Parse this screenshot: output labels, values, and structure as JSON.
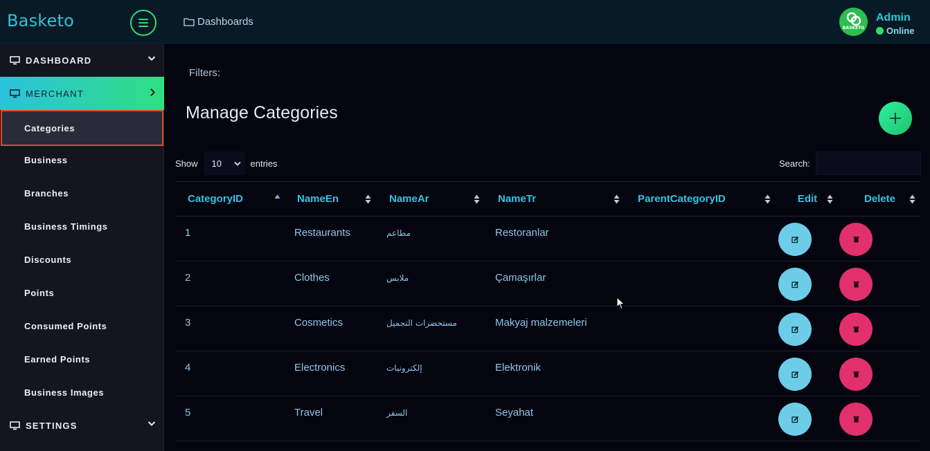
{
  "app": {
    "brand": "Basketo"
  },
  "breadcrumb": {
    "label": "Dashboards"
  },
  "user": {
    "name": "Admin",
    "status": "Online",
    "avatar_text": "BASKETO"
  },
  "sidebar": {
    "sections": {
      "dashboard": "DASHBOARD",
      "merchant": "MERCHANT",
      "settings": "SETTINGS"
    },
    "items": [
      "Categories",
      "Business",
      "Branches",
      "Business Timings",
      "Discounts",
      "Points",
      "Consumed Points",
      "Earned Points",
      "Business Images"
    ]
  },
  "main": {
    "filters_label": "Filters:",
    "title": "Manage Categories",
    "show_label": "Show",
    "entries_value": "10",
    "entries_label": "entries",
    "search_label": "Search:"
  },
  "table": {
    "columns": [
      "CategoryID",
      "NameEn",
      "NameAr",
      "NameTr",
      "ParentCategoryID",
      "Edit",
      "Delete"
    ],
    "rows": [
      [
        "1",
        "Restaurants",
        "مطاعم",
        "Restoranlar",
        ""
      ],
      [
        "2",
        "Clothes",
        "ملابس",
        "Çamaşırlar",
        ""
      ],
      [
        "3",
        "Cosmetics",
        "مستحضرات التجميل",
        "Makyaj malzemeleri",
        ""
      ],
      [
        "4",
        "Electronics",
        "إلكترونيات",
        "Elektronik",
        ""
      ],
      [
        "5",
        "Travel",
        "السفر",
        "Seyahat",
        ""
      ]
    ]
  },
  "colors": {
    "accent_green": "#2ee06a",
    "accent_cyan": "#2fc3d6",
    "edit_button": "#6dcde8",
    "delete_button": "#e1306c",
    "selected_outline": "#e04a2c"
  },
  "icons": [
    "hamburger-icon",
    "folder-icon",
    "monitor-icon",
    "chevron-down-icon",
    "chevron-right-icon",
    "plus-icon",
    "sort-icon",
    "edit-icon",
    "trash-icon"
  ]
}
